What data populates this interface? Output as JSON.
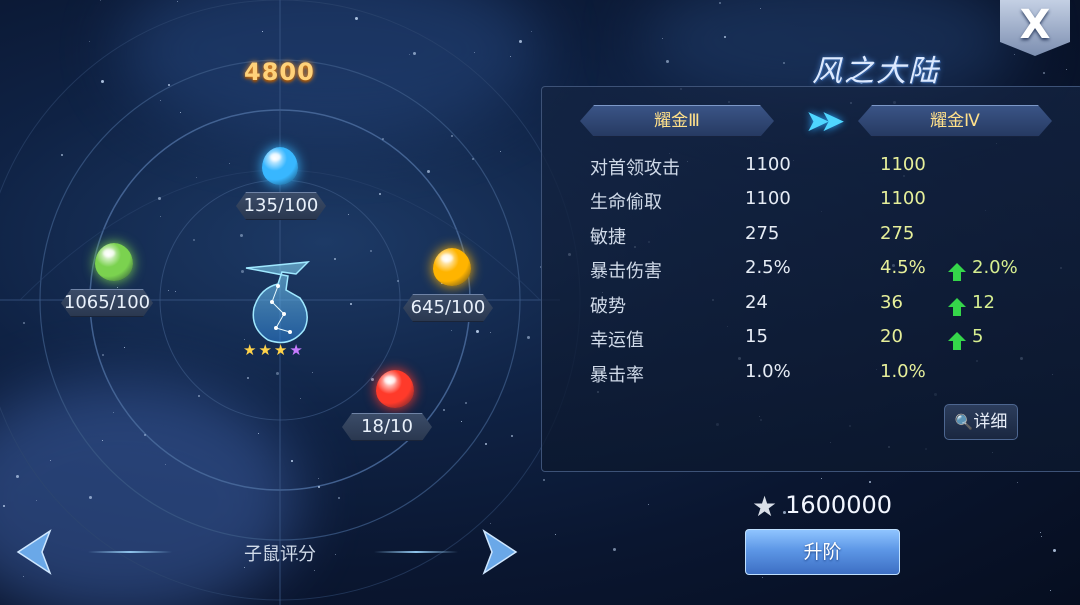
{
  "score": "4800",
  "logo_text": "风之大陆",
  "close_label": "X",
  "gems": [
    {
      "name": "blue",
      "label": "135/100",
      "color": "#38b7ff"
    },
    {
      "name": "green",
      "label": "1065/100",
      "color": "#7bd24f"
    },
    {
      "name": "yellow",
      "label": "645/100",
      "color": "#ffb400"
    },
    {
      "name": "red",
      "label": "18/10",
      "color": "#ff3a2a"
    }
  ],
  "constellation": {
    "stars": [
      "★",
      "★",
      "★",
      "★"
    ],
    "star_colors": [
      "#ffd34a",
      "#ffd34a",
      "#ffd34a",
      "#c77bff"
    ]
  },
  "rank": {
    "current": "耀金Ⅲ",
    "next": "耀金Ⅳ"
  },
  "stats": [
    {
      "name": "对首领攻击",
      "current": "1100",
      "next": "1100",
      "increase": ""
    },
    {
      "name": "生命偷取",
      "current": "1100",
      "next": "1100",
      "increase": ""
    },
    {
      "name": "敏捷",
      "current": "275",
      "next": "275",
      "increase": ""
    },
    {
      "name": "暴击伤害",
      "current": "2.5%",
      "next": "4.5%",
      "increase": "2.0%"
    },
    {
      "name": "破势",
      "current": "24",
      "next": "36",
      "increase": "12"
    },
    {
      "name": "幸运值",
      "current": "15",
      "next": "20",
      "increase": "5"
    },
    {
      "name": "暴击率",
      "current": "1.0%",
      "next": "1.0%",
      "increase": ""
    }
  ],
  "detail_label": "详细",
  "cost": "1600000",
  "upgrade_label": "升阶",
  "bottom_label": "子鼠评分"
}
